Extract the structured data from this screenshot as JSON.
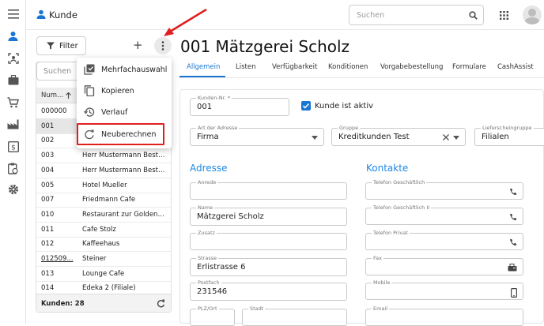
{
  "app": {
    "title": "Kunde"
  },
  "search": {
    "placeholder": "Suchen"
  },
  "left": {
    "filter_label": "Filter",
    "search_placeholder": "Suchen",
    "col_header": "Num...",
    "rows": [
      {
        "num": "000000",
        "name": "",
        "underlined": false
      },
      {
        "num": "001",
        "name": "",
        "underlined": false,
        "selected": true
      },
      {
        "num": "002",
        "name": "",
        "underlined": false
      },
      {
        "num": "003",
        "name": "Herr Mustermann Bestellu...",
        "underlined": false
      },
      {
        "num": "004",
        "name": "Herr Mustermann Bestellu...",
        "underlined": false
      },
      {
        "num": "005",
        "name": "Hotel Mueller",
        "underlined": false
      },
      {
        "num": "007",
        "name": "Friedmann Cafe",
        "underlined": false
      },
      {
        "num": "010",
        "name": "Restaurant zur Goldenen L...",
        "underlined": false
      },
      {
        "num": "011",
        "name": "Cafe Stolz",
        "underlined": false
      },
      {
        "num": "012",
        "name": "Kaffeehaus",
        "underlined": false
      },
      {
        "num": "012509...",
        "name": "Steiner",
        "underlined": true
      },
      {
        "num": "013",
        "name": "Lounge Cafe",
        "underlined": false
      },
      {
        "num": "014",
        "name": "Edeka 2 (Filiale)",
        "underlined": false
      }
    ],
    "footer": "Kunden: 28"
  },
  "menu": {
    "items": [
      {
        "label": "Mehrfachauswahl",
        "icon": "multi-select-icon"
      },
      {
        "label": "Kopieren",
        "icon": "copy-icon"
      },
      {
        "label": "Verlauf",
        "icon": "history-icon"
      },
      {
        "label": "Neuberechnen",
        "icon": "refresh-icon"
      }
    ]
  },
  "main": {
    "title": "001 Mätzgerei Scholz",
    "tabs": [
      "Allgemein",
      "Listen",
      "Verfügbarkeit",
      "Konditionen",
      "Vorgabebestellung",
      "Formulare",
      "CashAssist"
    ],
    "active_tab": "Allgemein",
    "kundennr_label": "Kunden-Nr. *",
    "kundennr_value": "001",
    "aktiv_label": "Kunde ist aktiv",
    "artadresse_label": "Art der Adresse",
    "artadresse_value": "Firma",
    "gruppe_label": "Gruppe",
    "gruppe_value": "Kreditkunden Test",
    "lieferschein_label": "Lieferscheingruppe",
    "lieferschein_value": "Filialen",
    "adresse_heading": "Adresse",
    "kontakte_heading": "Kontakte",
    "anrede_label": "Anrede",
    "anrede_value": "",
    "name_label": "Name",
    "name_value": "Mätzgerei Scholz",
    "zusatz_label": "Zusatz",
    "strasse_label": "Strasse",
    "strasse_value": "Erlistrasse 6",
    "postfach_label": "Postfach",
    "postfach_value": "231546",
    "plzort_label": "PLZ/Ort",
    "stadt_label": "Stadt",
    "tel_label": "Telefon Geschäftlich",
    "tel2_label": "Telefon Geschäftlich II",
    "telp_label": "Telefon Privat",
    "fax_label": "Fax",
    "mobile_label": "Mobile",
    "email_label": "Email"
  },
  "colors": {
    "accent": "#1976d2",
    "highlight": "#e01e1e"
  }
}
